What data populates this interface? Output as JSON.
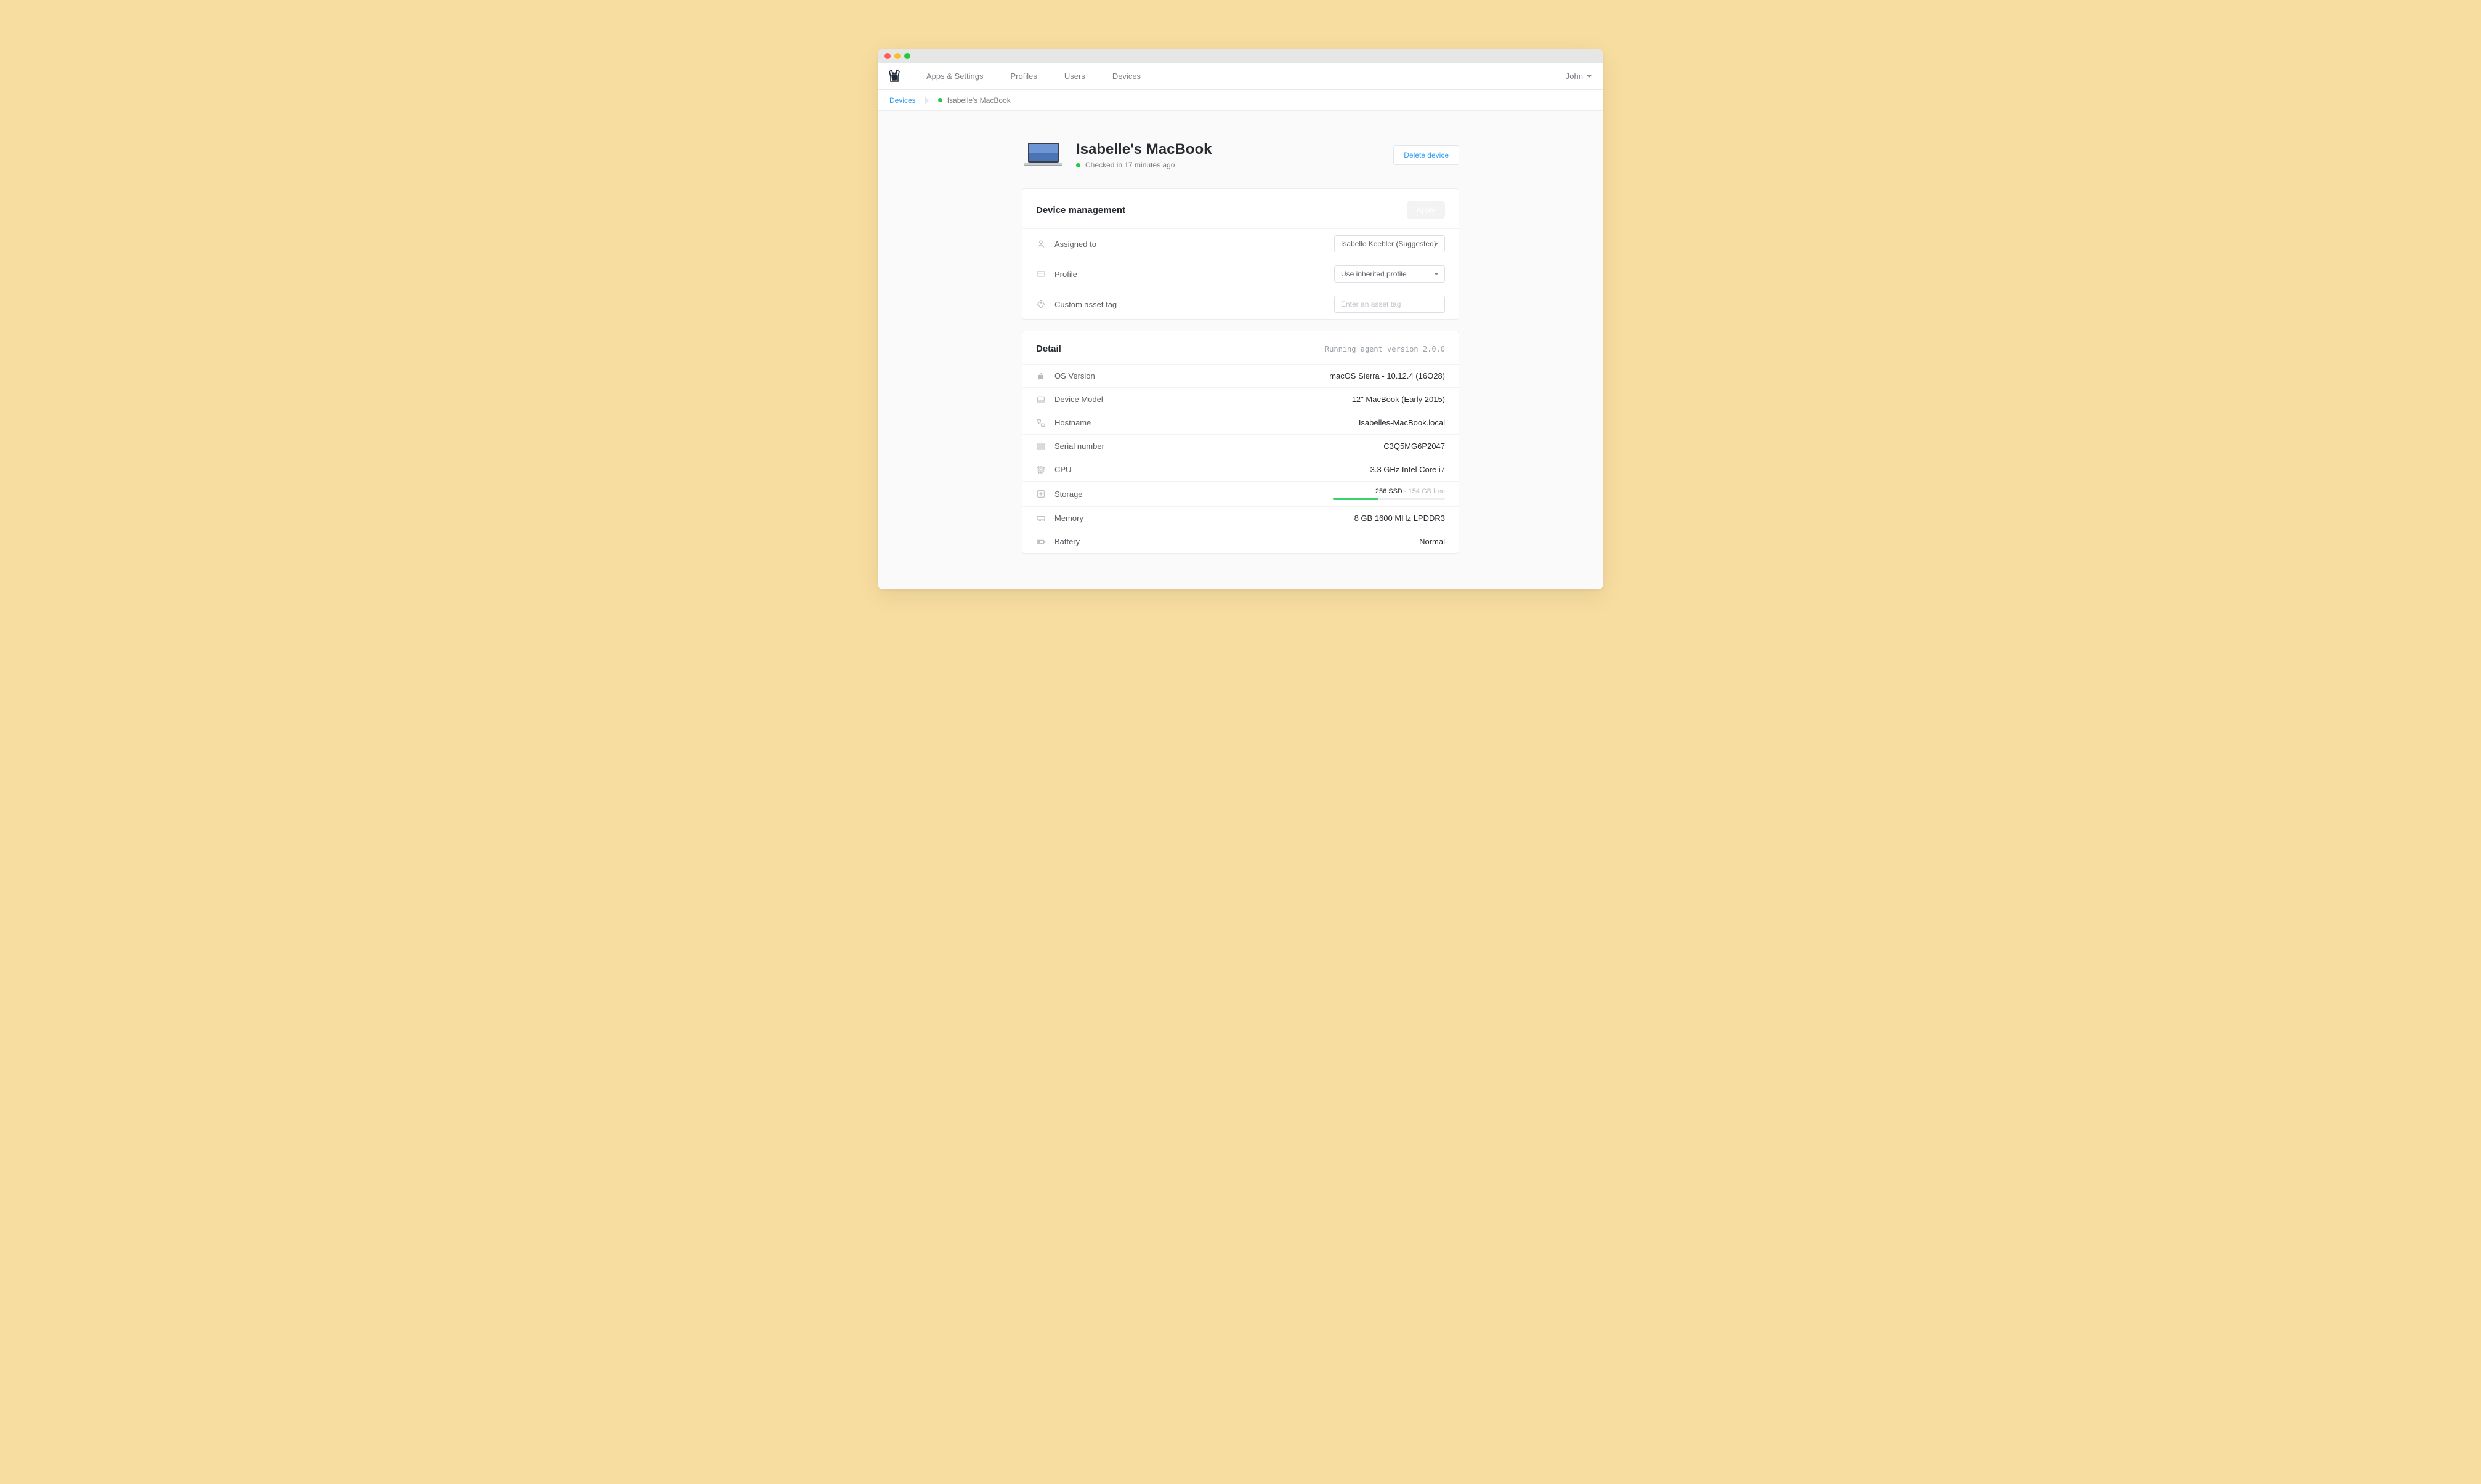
{
  "nav": {
    "items": [
      "Apps & Settings",
      "Profiles",
      "Users",
      "Devices"
    ],
    "user": "John"
  },
  "breadcrumb": {
    "root": "Devices",
    "current": "Isabelle's MacBook"
  },
  "device": {
    "name": "Isabelle's MacBook",
    "status": "Checked in 17 minutes ago",
    "delete_label": "Delete device"
  },
  "management": {
    "title": "Device management",
    "apply_label": "Apply",
    "assigned_label": "Assigned to",
    "assigned_value": "Isabelle Keebler (Suggested)",
    "profile_label": "Profile",
    "profile_value": "Use inherited profile",
    "tag_label": "Custom asset tag",
    "tag_placeholder": "Enter an asset tag"
  },
  "detail": {
    "title": "Detail",
    "agent_version": "Running agent version 2.0.0",
    "os_label": "OS Version",
    "os_value": "macOS Sierra - 10.12.4 (16O28)",
    "model_label": "Device Model",
    "model_value": "12\" MacBook (Early 2015)",
    "hostname_label": "Hostname",
    "hostname_value": "Isabelles-MacBook.local",
    "serial_label": "Serial number",
    "serial_value": "C3Q5MG6P2047",
    "cpu_label": "CPU",
    "cpu_value": "3.3 GHz Intel Core i7",
    "storage_label": "Storage",
    "storage_total": "256 SSD",
    "storage_free": "154 GB free",
    "storage_used_pct": 40,
    "memory_label": "Memory",
    "memory_value": "8 GB 1600 MHz LPDDR3",
    "battery_label": "Battery",
    "battery_value": "Normal"
  }
}
